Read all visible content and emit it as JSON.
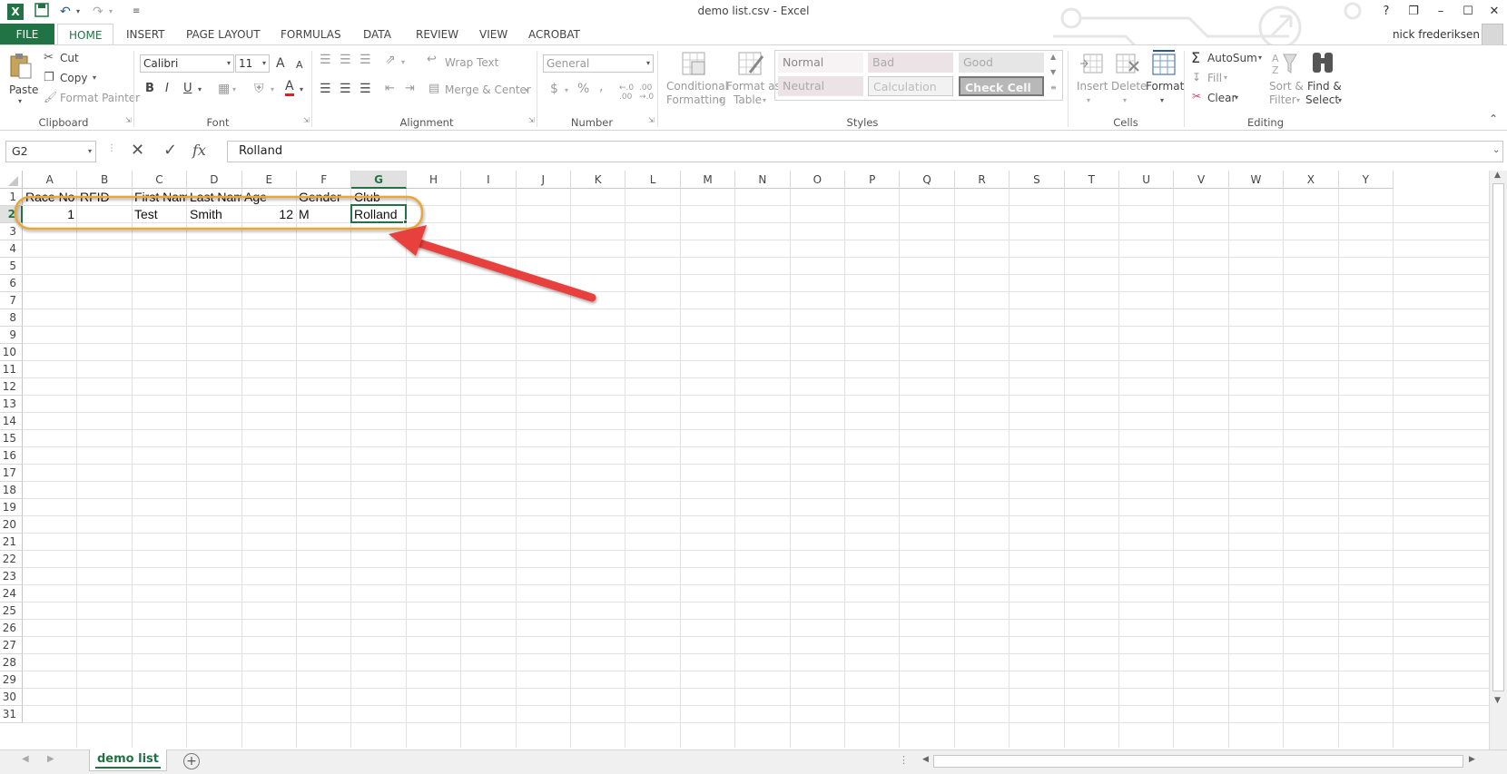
{
  "window": {
    "title": "demo list.csv - Excel"
  },
  "titlebar": {
    "help": "?",
    "restore_ribbon": "❐",
    "minimize": "–",
    "maximize": "☐",
    "close": "✕"
  },
  "tabs": [
    "FILE",
    "HOME",
    "INSERT",
    "PAGE LAYOUT",
    "FORMULAS",
    "DATA",
    "REVIEW",
    "VIEW",
    "ACROBAT"
  ],
  "user": {
    "name": "nick frederiksen"
  },
  "clipboard": {
    "paste": "Paste",
    "cut": "Cut",
    "copy": "Copy",
    "format_painter": "Format Painter",
    "label": "Clipboard"
  },
  "font": {
    "name": "Calibri",
    "size": "11",
    "label": "Font",
    "bold": "B",
    "italic": "I",
    "underline": "U",
    "grow": "A",
    "shrink": "A",
    "color": "A"
  },
  "alignment": {
    "wrap": "Wrap Text",
    "merge": "Merge & Center",
    "label": "Alignment"
  },
  "number": {
    "format": "General",
    "currency": "$",
    "percent": "%",
    "comma": ",",
    "label": "Number"
  },
  "styles": {
    "conditional": "Conditional",
    "conditional2": "Formatting",
    "format_as": "Format as",
    "format_as2": "Table",
    "normal": "Normal",
    "bad": "Bad",
    "good": "Good",
    "neutral": "Neutral",
    "calculation": "Calculation",
    "check_cell": "Check Cell",
    "label": "Styles"
  },
  "cells_group": {
    "insert": "Insert",
    "delete": "Delete",
    "format": "Format",
    "label": "Cells"
  },
  "editing": {
    "autosum": "AutoSum",
    "fill": "Fill",
    "clear": "Clear",
    "sort": "Sort &",
    "sort2": "Filter",
    "find": "Find &",
    "find2": "Select",
    "label": "Editing"
  },
  "formula_bar": {
    "name_box": "G2",
    "fx": "fx",
    "value": "Rolland"
  },
  "columns": [
    "A",
    "B",
    "C",
    "D",
    "E",
    "F",
    "G",
    "H",
    "I",
    "J",
    "K",
    "L",
    "M",
    "N",
    "O",
    "P",
    "Q",
    "R",
    "S",
    "T",
    "U",
    "V",
    "W",
    "X",
    "Y"
  ],
  "rows": [
    "1",
    "2",
    "3",
    "4",
    "5",
    "6",
    "7",
    "8",
    "9",
    "10",
    "11",
    "12",
    "13",
    "14",
    "15",
    "16",
    "17",
    "18",
    "19",
    "20",
    "21",
    "22",
    "23",
    "24",
    "25",
    "26",
    "27",
    "28",
    "29",
    "30",
    "31"
  ],
  "sheet": {
    "header": [
      "Race No",
      "RFID",
      "First Name",
      "Last Name",
      "Age",
      "Gender",
      "Club"
    ],
    "row2": [
      "1",
      "",
      "Test",
      "Smith",
      "12",
      "M",
      "Rolland"
    ]
  },
  "sheet_tab": "demo list",
  "colors": {
    "excel_green": "#217346",
    "annotation_orange": "#E8A63A",
    "annotation_red": "#E8413C"
  }
}
